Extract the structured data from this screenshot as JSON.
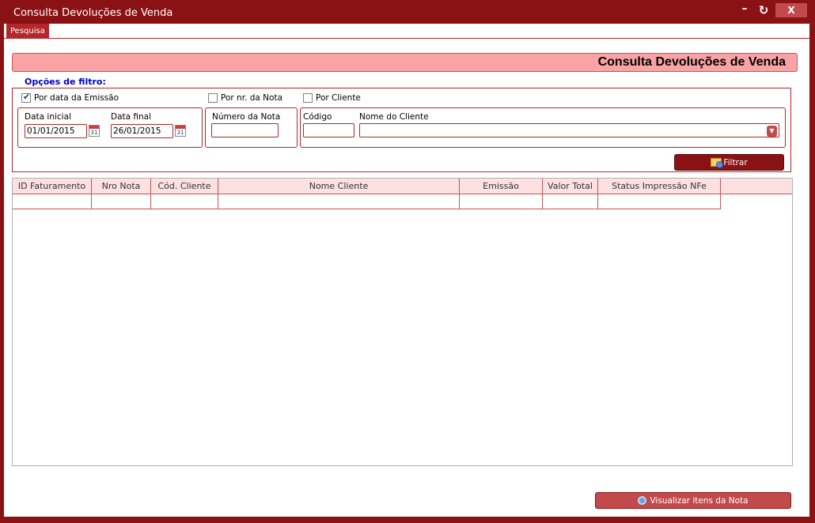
{
  "window": {
    "title": "Consulta Devoluções de Venda",
    "minimize_glyph": "–",
    "restore_glyph": "↻",
    "close_glyph": "X"
  },
  "tabs": [
    {
      "label": "Pesquisa"
    }
  ],
  "header": {
    "title": "Consulta Devoluções de Venda"
  },
  "filter": {
    "legend": "Opções de filtro:",
    "options": [
      {
        "label": "Por data da Emissão",
        "checked": true
      },
      {
        "label": "Por nr. da Nota",
        "checked": false
      },
      {
        "label": "Por Cliente",
        "checked": false
      }
    ],
    "data_inicial_label": "Data inicial",
    "data_inicial_value": "01/01/2015",
    "data_final_label": "Data final",
    "data_final_value": "26/01/2015",
    "calendar_day": "31",
    "numero_nota_label": "Número da Nota",
    "numero_nota_value": "",
    "codigo_label": "Código",
    "codigo_value": "",
    "nome_cliente_label": "Nome do Cliente",
    "nome_cliente_value": "",
    "filtrar_label": "Filtrar"
  },
  "grid": {
    "columns": [
      {
        "label": "ID Faturamento"
      },
      {
        "label": "Nro Nota"
      },
      {
        "label": "Cód. Cliente"
      },
      {
        "label": "Nome Cliente"
      },
      {
        "label": "Emissão"
      },
      {
        "label": "Valor Total"
      },
      {
        "label": "Status Impressão NFe"
      }
    ]
  },
  "footer": {
    "visualizar_label": "Visualizar itens da Nota"
  },
  "colors": {
    "accent": "#8b1214",
    "banner": "#f9a3a4",
    "legend": "#0000cc"
  },
  "icons": [
    "minimize-icon",
    "refresh-icon",
    "close-icon",
    "checkbox-icon",
    "calendar-icon",
    "dropdown-arrow-icon",
    "folder-search-icon",
    "magnifier-icon"
  ]
}
